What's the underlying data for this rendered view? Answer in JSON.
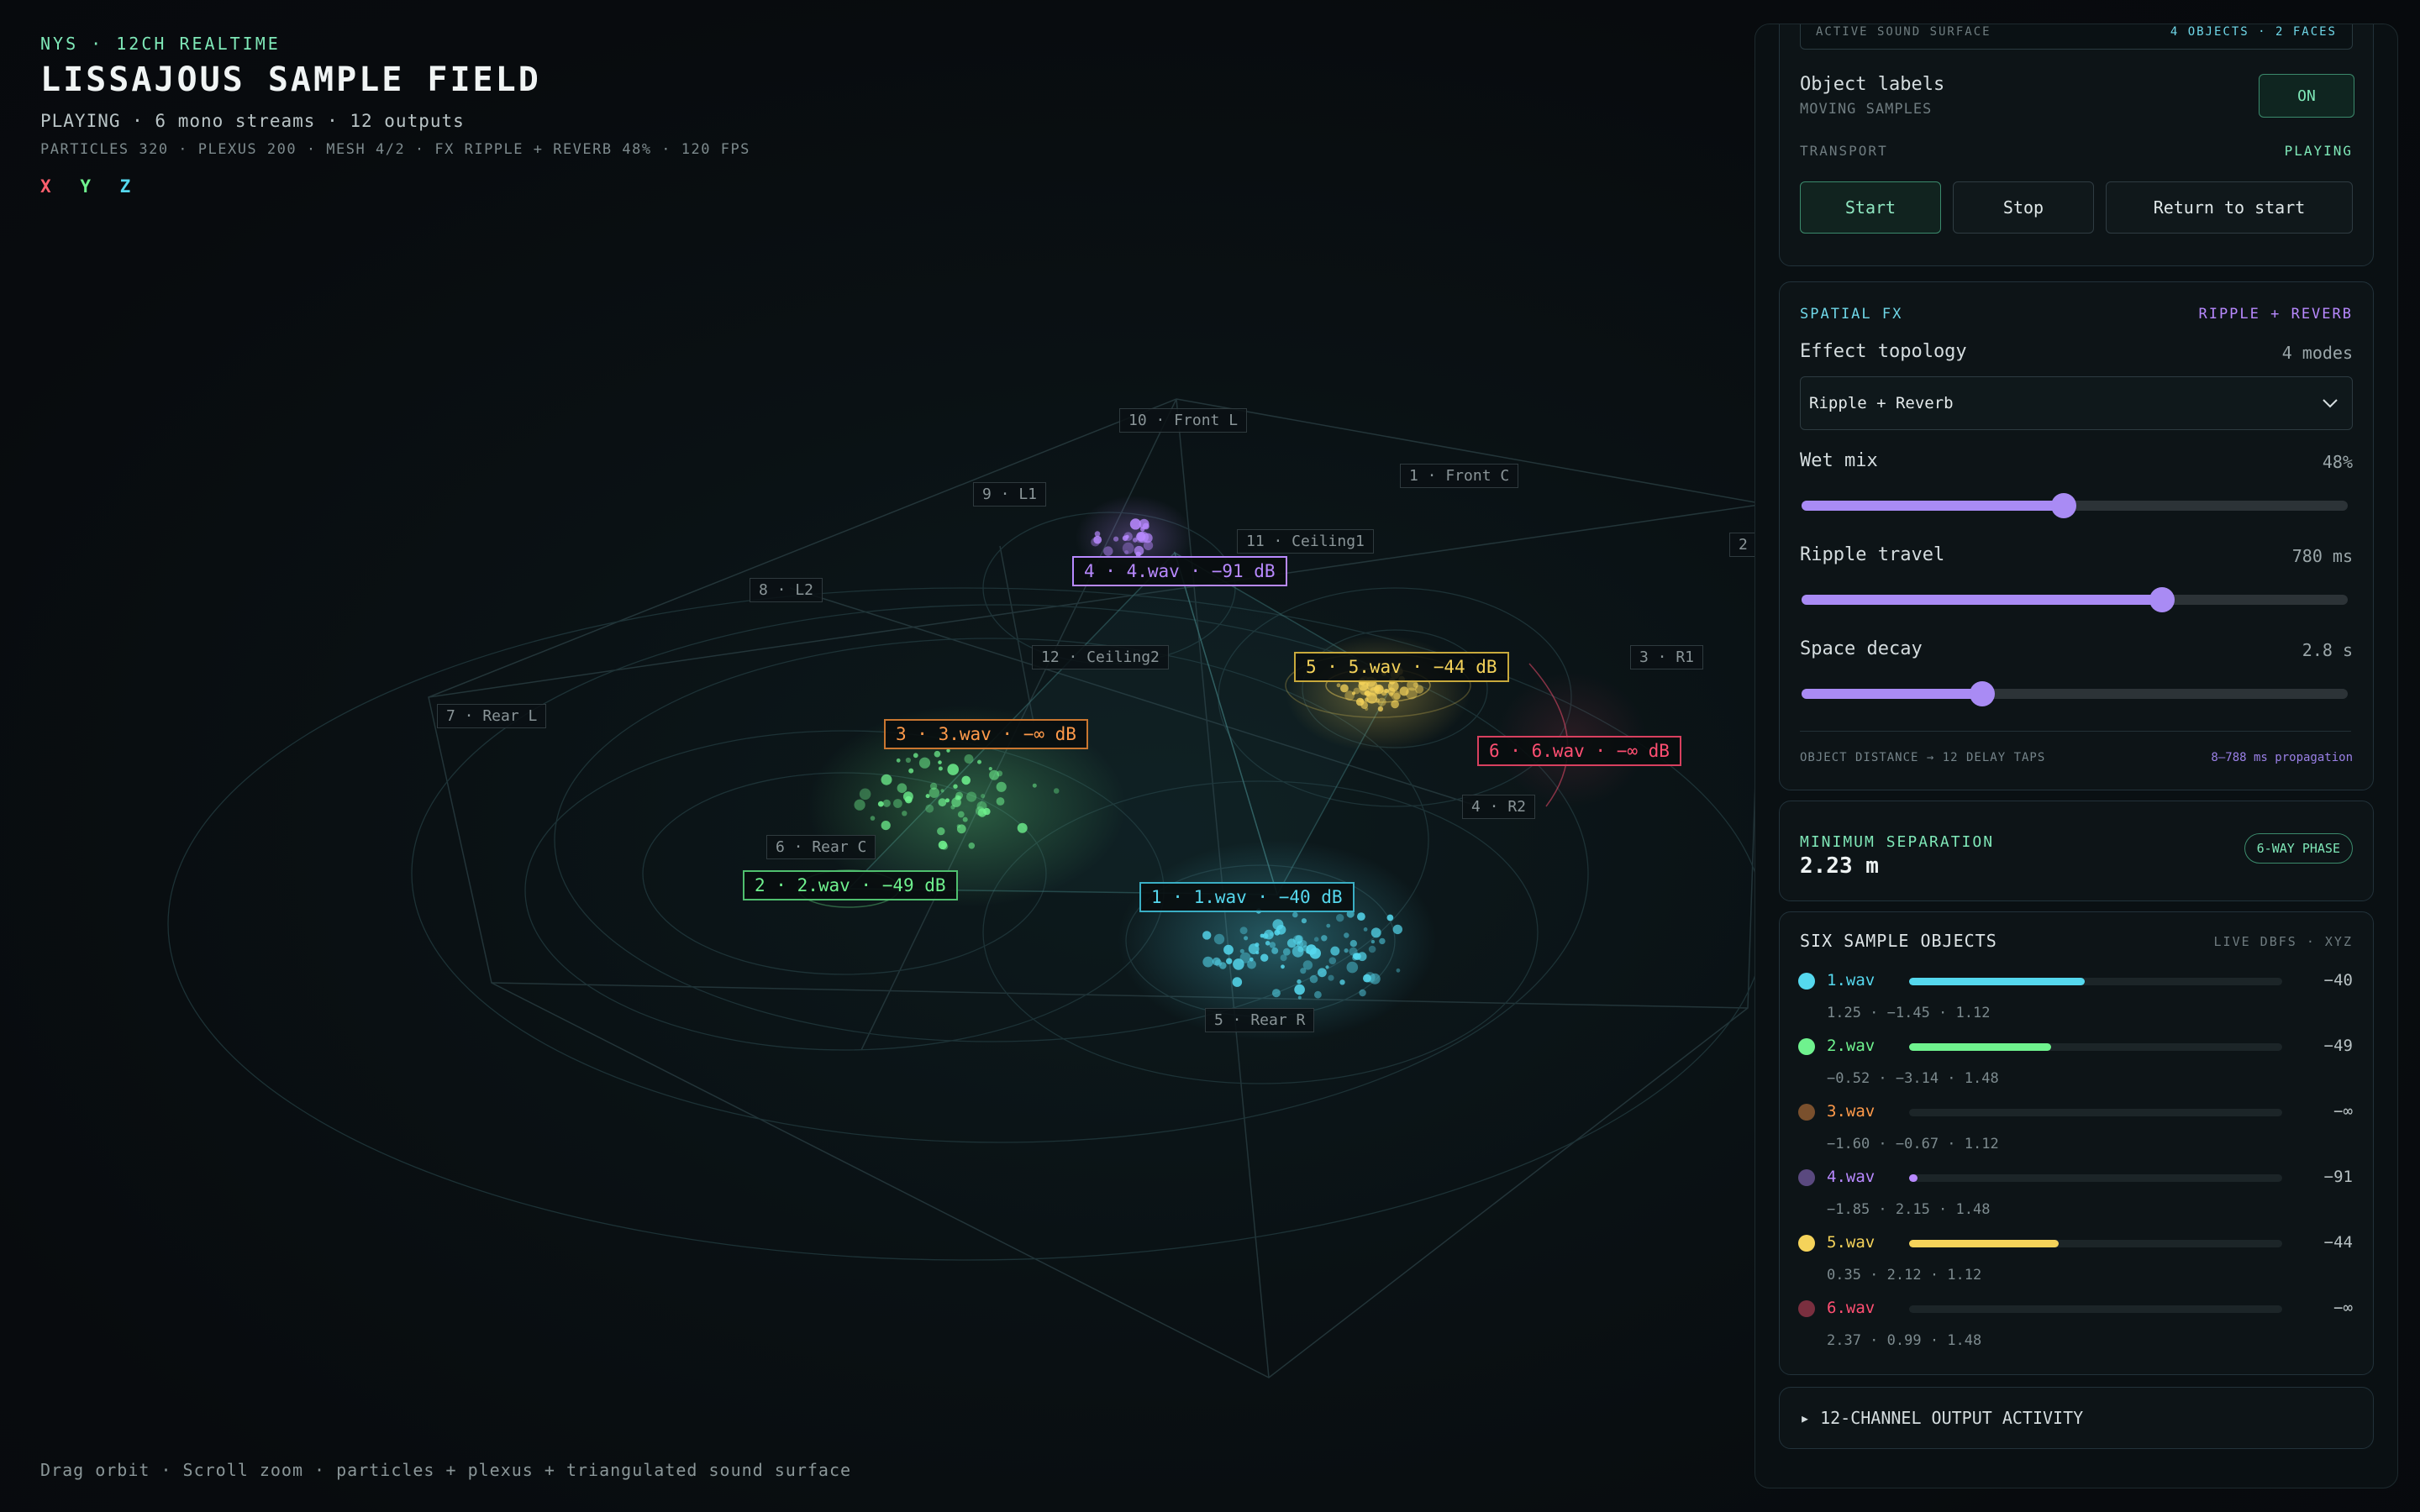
{
  "hud": {
    "eyebrow": "NYS · 12CH REALTIME",
    "title": "LISSAJOUS SAMPLE FIELD",
    "status": "PLAYING · 6 mono streams · 12 outputs",
    "stats": "PARTICLES 320 · PLEXUS 200 · MESH 4/2 · FX RIPPLE + REVERB 48% · 120 FPS",
    "axes": {
      "x": "X",
      "y": "Y",
      "z": "Z"
    },
    "hint": "Drag orbit · Scroll zoom · particles + plexus + triangulated sound surface"
  },
  "speakers": [
    {
      "label": "10 · Front L"
    },
    {
      "label": "1 · Front C"
    },
    {
      "label": "9 · L1"
    },
    {
      "label": "11 · Ceiling1"
    },
    {
      "label": "2"
    },
    {
      "label": "8 · L2"
    },
    {
      "label": "12 · Ceiling2"
    },
    {
      "label": "3 · R1"
    },
    {
      "label": "7 · Rear L"
    },
    {
      "label": "4 · R2"
    },
    {
      "label": "6 · Rear C"
    },
    {
      "label": "5 · Rear R"
    }
  ],
  "objects": [
    {
      "label": "4 · 4.wav · −91 dB",
      "color": "#b889ff"
    },
    {
      "label": "5 · 5.wav · −44 dB",
      "color": "#f5d35a"
    },
    {
      "label": "3 · 3.wav · −∞ dB",
      "color": "#ff9a4a"
    },
    {
      "label": "6 · 6.wav · −∞ dB",
      "color": "#ff4f72"
    },
    {
      "label": "2 · 2.wav · −49 dB",
      "color": "#6ff28e"
    },
    {
      "label": "1 · 1.wav · −40 dB",
      "color": "#55d8ee"
    }
  ],
  "panel": {
    "surface": {
      "label": "ACTIVE SOUND SURFACE",
      "value": "4 OBJECTS · 2 FACES"
    },
    "object_labels": {
      "label": "Object labels",
      "sub": "MOVING SAMPLES",
      "toggle": "ON"
    },
    "transport": {
      "label": "TRANSPORT",
      "state": "PLAYING",
      "start": "Start",
      "stop": "Stop",
      "return": "Return to start"
    },
    "fx": {
      "title": "SPATIAL FX",
      "badge": "RIPPLE + REVERB",
      "topology_label": "Effect topology",
      "topology_count": "4 modes",
      "topology_value": "Ripple + Reverb",
      "wet_label": "Wet mix",
      "wet_value": "48%",
      "wet_level": 0.48,
      "ripple_label": "Ripple travel",
      "ripple_value": "780 ms",
      "ripple_level": 0.66,
      "decay_label": "Space decay",
      "decay_value": "2.8 s",
      "decay_level": 0.33,
      "footer_left": "OBJECT DISTANCE → 12 DELAY TAPS",
      "footer_right": "8–788 ms propagation"
    },
    "separation": {
      "label": "MINIMUM SEPARATION",
      "value": "2.23 m",
      "badge": "6-WAY PHASE"
    },
    "samples": {
      "title": "SIX SAMPLE OBJECTS",
      "meta": "LIVE DBFS · XYZ",
      "rows": [
        {
          "name": "1.wav",
          "db": "−40",
          "pos": "1.25 · −1.45 · 1.12",
          "color": "#55d8ee",
          "level": 0.47
        },
        {
          "name": "2.wav",
          "db": "−49",
          "pos": "−0.52 · −3.14 · 1.48",
          "color": "#6ff28e",
          "level": 0.38
        },
        {
          "name": "3.wav",
          "db": "−∞",
          "pos": "−1.60 · −0.67 · 1.12",
          "color": "#ff9a4a",
          "level": 0.0
        },
        {
          "name": "4.wav",
          "db": "−91",
          "pos": "−1.85 · 2.15 · 1.48",
          "color": "#b889ff",
          "level": 0.02
        },
        {
          "name": "5.wav",
          "db": "−44",
          "pos": "0.35 · 2.12 · 1.12",
          "color": "#f5d35a",
          "level": 0.4
        },
        {
          "name": "6.wav",
          "db": "−∞",
          "pos": "2.37 · 0.99 · 1.48",
          "color": "#ff4f72",
          "level": 0.0
        }
      ]
    },
    "channels": {
      "label": "▸ 12-CHANNEL OUTPUT ACTIVITY"
    }
  }
}
